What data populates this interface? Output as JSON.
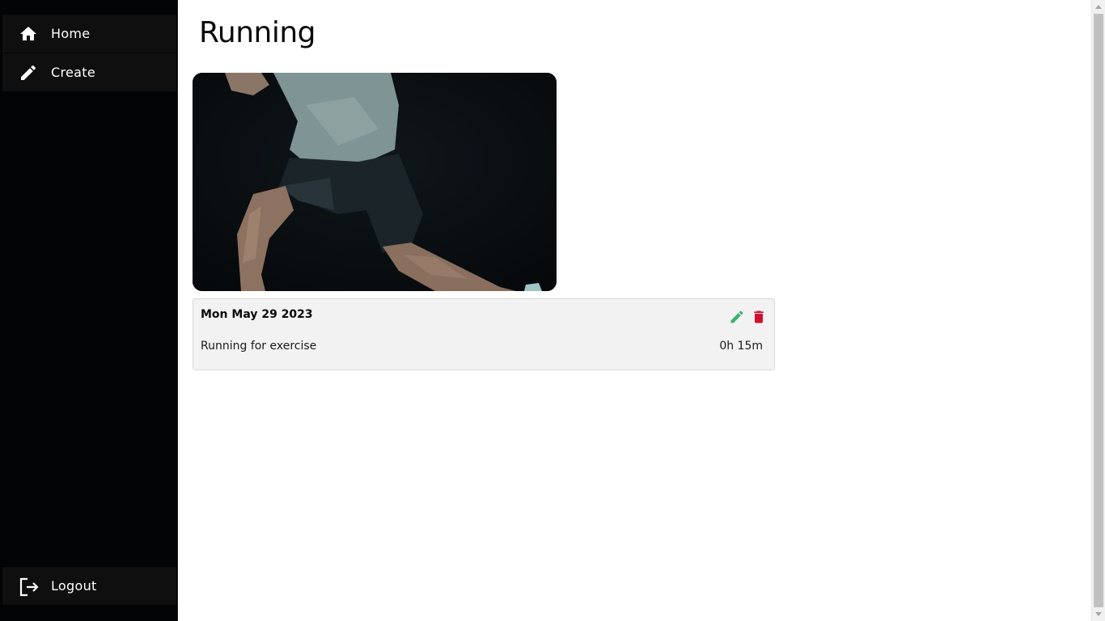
{
  "sidebar": {
    "items": [
      {
        "label": "Home",
        "icon": "home-icon"
      },
      {
        "label": "Create",
        "icon": "pencil-icon"
      }
    ],
    "logout": {
      "label": "Logout",
      "icon": "logout-icon"
    }
  },
  "main": {
    "title": "Running",
    "entry": {
      "date": "Mon May 29 2023",
      "description": "Running for exercise",
      "duration": "0h 15m",
      "edit_icon": "pencil-icon",
      "delete_icon": "trash-icon"
    }
  },
  "colors": {
    "sidebar_bg": "#030405",
    "nav_item_bg": "#0f0f10",
    "edit": "#3cb371",
    "delete": "#d0102e",
    "card_bg": "#f2f2f2"
  }
}
